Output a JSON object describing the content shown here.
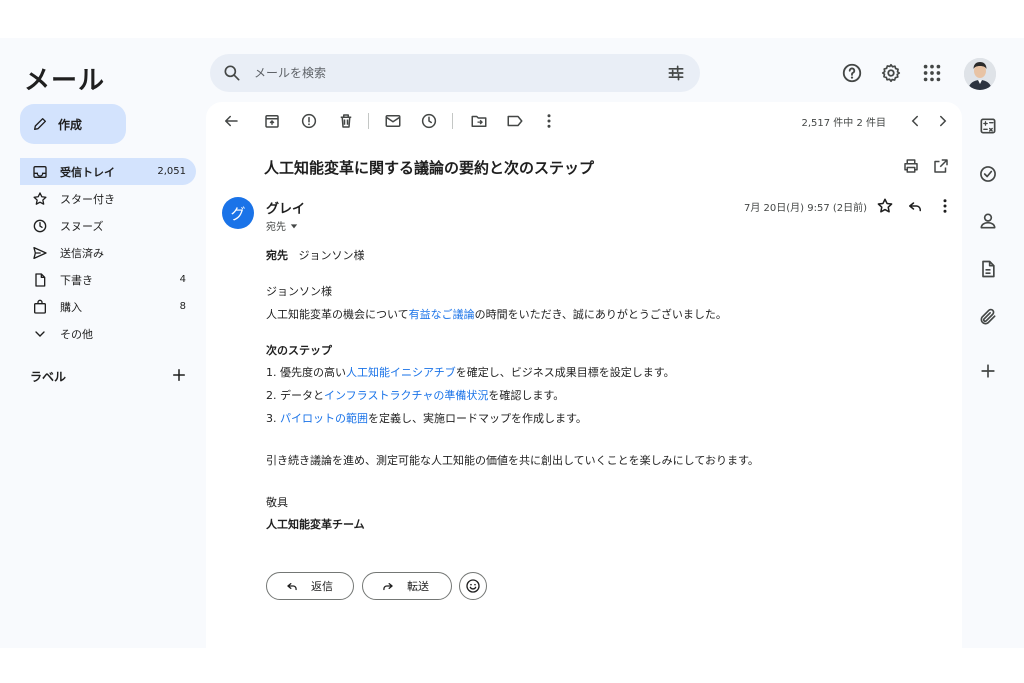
{
  "app": {
    "title": "メール"
  },
  "search": {
    "placeholder": "メールを検索"
  },
  "compose": {
    "label": "作成"
  },
  "nav": [
    {
      "id": "inbox",
      "label": "受信トレイ",
      "count": "2,051",
      "icon": "inbox-icon",
      "active": true
    },
    {
      "id": "starred",
      "label": "スター付き",
      "count": "",
      "icon": "star-icon"
    },
    {
      "id": "snoozed",
      "label": "スヌーズ",
      "count": "",
      "icon": "clock-icon"
    },
    {
      "id": "sent",
      "label": "送信済み",
      "count": "",
      "icon": "send-icon"
    },
    {
      "id": "drafts",
      "label": "下書き",
      "count": "4",
      "icon": "draft-icon"
    },
    {
      "id": "purchases",
      "label": "購入",
      "count": "8",
      "icon": "bag-icon"
    },
    {
      "id": "more",
      "label": "その他",
      "count": "",
      "icon": "chevron-down-icon"
    }
  ],
  "labels": {
    "heading": "ラベル"
  },
  "toolbar": {
    "count": "2,517 件中 2 件目"
  },
  "email": {
    "subject": "人工知能変革に関する議論の要約と次のステップ",
    "sender_initial": "グ",
    "sender_name": "グレイ",
    "to_short": "宛先",
    "date": "7月 20日(月) 9:57 (2日前)",
    "to_label": "宛先",
    "to_name": "ジョンソン様",
    "greeting": "ジョンソン様",
    "line1_a": "人工知能変革の機会について",
    "line1_link": "有益なご議論",
    "line1_b": "の時間をいただき、誠にありがとうございました。",
    "next_heading": "次のステップ",
    "step1_a": "1. 優先度の高い",
    "step1_link": "人工知能イニシアチブ",
    "step1_b": "を確定し、ビジネス成果目標を設定します。",
    "step2_a": "2. データと",
    "step2_link": "インフラストラクチャの準備状況",
    "step2_b": "を確認します。",
    "step3_a": "3. ",
    "step3_link": "パイロットの範囲",
    "step3_b": "を定義し、実施ロードマップを作成します。",
    "closing": "引き続き議論を進め、測定可能な人工知能の価値を共に創出していくことを楽しみにしております。",
    "regards": "敬具",
    "signature": "人工知能変革チーム"
  },
  "actions": {
    "reply": "返信",
    "forward": "転送"
  },
  "colors": {
    "accent": "#1a73e8",
    "compose_bg": "#d3e3fd",
    "active_nav": "#d3e3fd",
    "search_bg": "#e9eef6"
  }
}
